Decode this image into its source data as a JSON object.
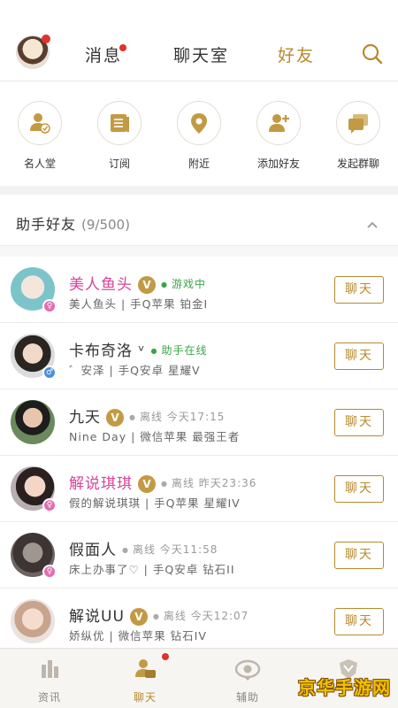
{
  "top_tabs": {
    "messages": "消息",
    "chat_room": "聊天室",
    "friends": "好友"
  },
  "shortcuts": [
    {
      "label": "名人堂",
      "icon": "hall-of-fame-icon"
    },
    {
      "label": "订阅",
      "icon": "subscribe-icon"
    },
    {
      "label": "附近",
      "icon": "location-icon"
    },
    {
      "label": "添加好友",
      "icon": "add-friend-icon"
    },
    {
      "label": "发起群聊",
      "icon": "group-chat-icon"
    }
  ],
  "group": {
    "title": "助手好友",
    "count": "(9/500)"
  },
  "friends": [
    {
      "name": "美人鱼头",
      "vip": "V",
      "status": "游戏中",
      "status_type": "online",
      "sub": "美人鱼头 | 手Q苹果 铂金I",
      "gender": "female",
      "name_color": "#d9439a"
    },
    {
      "name": "卡布奇洛 ᵛ",
      "vip": "",
      "status": "助手在线",
      "status_type": "online",
      "sub": "゛安泽 | 手Q安卓 星耀V",
      "gender": "male",
      "name_color": "#333333"
    },
    {
      "name": "九天",
      "vip": "V",
      "status": "离线 今天17:15",
      "status_type": "offline",
      "sub": "Nine Day | 微信苹果 最强王者",
      "gender": "",
      "name_color": "#333333"
    },
    {
      "name": "解说琪琪",
      "vip": "V",
      "status": "离线 昨天23:36",
      "status_type": "offline",
      "sub": "假的解说琪琪 | 手Q苹果 星耀IV",
      "gender": "female",
      "name_color": "#d9439a"
    },
    {
      "name": "假面人",
      "vip": "",
      "status": "离线 今天11:58",
      "status_type": "offline",
      "sub": "床上办事了♡ | 手Q安卓 钻石II",
      "gender": "female",
      "name_color": "#333333"
    },
    {
      "name": "解说UU",
      "vip": "V",
      "status": "离线 今天12:07",
      "status_type": "offline",
      "sub": "娇纵优 | 微信苹果 钻石IV",
      "gender": "",
      "name_color": "#333333"
    }
  ],
  "chat_button_label": "聊天",
  "bottom_nav": [
    {
      "label": "资讯",
      "icon": "news-icon",
      "active": false
    },
    {
      "label": "聊天",
      "icon": "chat-icon",
      "active": true
    },
    {
      "label": "辅助",
      "icon": "assist-icon",
      "active": false
    },
    {
      "label": "",
      "icon": "shield-icon",
      "active": false
    }
  ],
  "watermark": "京华手游网",
  "colors": {
    "accent": "#b8892c",
    "pink": "#d9439a",
    "online": "#3aa544",
    "badge_red": "#e0322e"
  }
}
